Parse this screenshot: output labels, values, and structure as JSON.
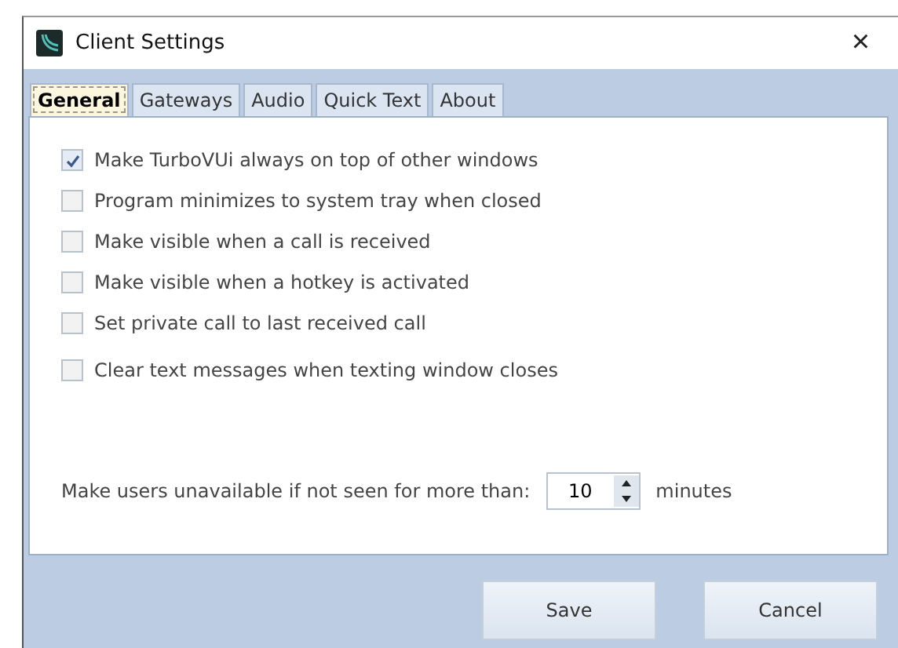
{
  "window": {
    "title": "Client Settings",
    "close": "×"
  },
  "tabs": [
    {
      "label": "General",
      "selected": true
    },
    {
      "label": "Gateways",
      "selected": false
    },
    {
      "label": "Audio",
      "selected": false
    },
    {
      "label": "Quick Text",
      "selected": false
    },
    {
      "label": "About",
      "selected": false
    }
  ],
  "options": [
    {
      "label": "Make TurboVUi always on top of other windows",
      "checked": true
    },
    {
      "label": "Program minimizes to system tray when closed",
      "checked": false
    },
    {
      "label": "Make visible when a call is received",
      "checked": false
    },
    {
      "label": "Make visible when a hotkey is activated",
      "checked": false
    },
    {
      "label": "Set private call to last received call",
      "checked": false
    },
    {
      "label": "Clear text messages when texting window closes",
      "checked": false
    }
  ],
  "timeout": {
    "label": "Make users unavailable if not seen for more than:",
    "value": "10",
    "unit": "minutes"
  },
  "buttons": [
    "Save",
    "Cancel"
  ]
}
